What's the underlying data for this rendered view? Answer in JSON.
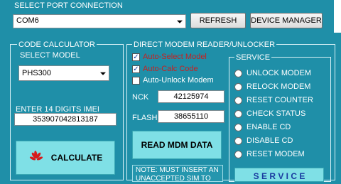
{
  "port": {
    "title": "SELECT PORT CONNECTION",
    "selected": "COM6",
    "refresh_label": "REFRESH",
    "device_manager_label": "DEVICE MANAGER"
  },
  "calculator": {
    "title": "CODE CALCULATOR",
    "model_title": "SELECT MODEL",
    "model_selected": "PHS300",
    "imei_label": "ENTER 14 DIGITS IMEI",
    "imei_value": "353907042813187",
    "calculate_label": "CALCULATE"
  },
  "reader": {
    "title": "DIRECT MODEM READER/UNLOCKER",
    "options": [
      {
        "label": "Auto-Select Model",
        "checked": true
      },
      {
        "label": "Auto-Calc Code",
        "checked": true
      },
      {
        "label": "Auto-Unlock Modem",
        "checked": false
      }
    ],
    "nck_label": "NCK",
    "nck_value": "42125974",
    "flash_label": "FLASH",
    "flash_value": "38655110",
    "read_button_label": "READ MDM DATA",
    "note": "NOTE: MUST INSERT AN UNACCEPTED SIM TO"
  },
  "service": {
    "title": "SERVICE",
    "items": [
      "UNLOCK MODEM",
      "RELOCK MODEM",
      "RESET COUNTER",
      "CHECK STATUS",
      "ENABLE CD",
      "DISABLE CD",
      "RESET MODEM"
    ],
    "button_label": "S E R V I C E"
  }
}
